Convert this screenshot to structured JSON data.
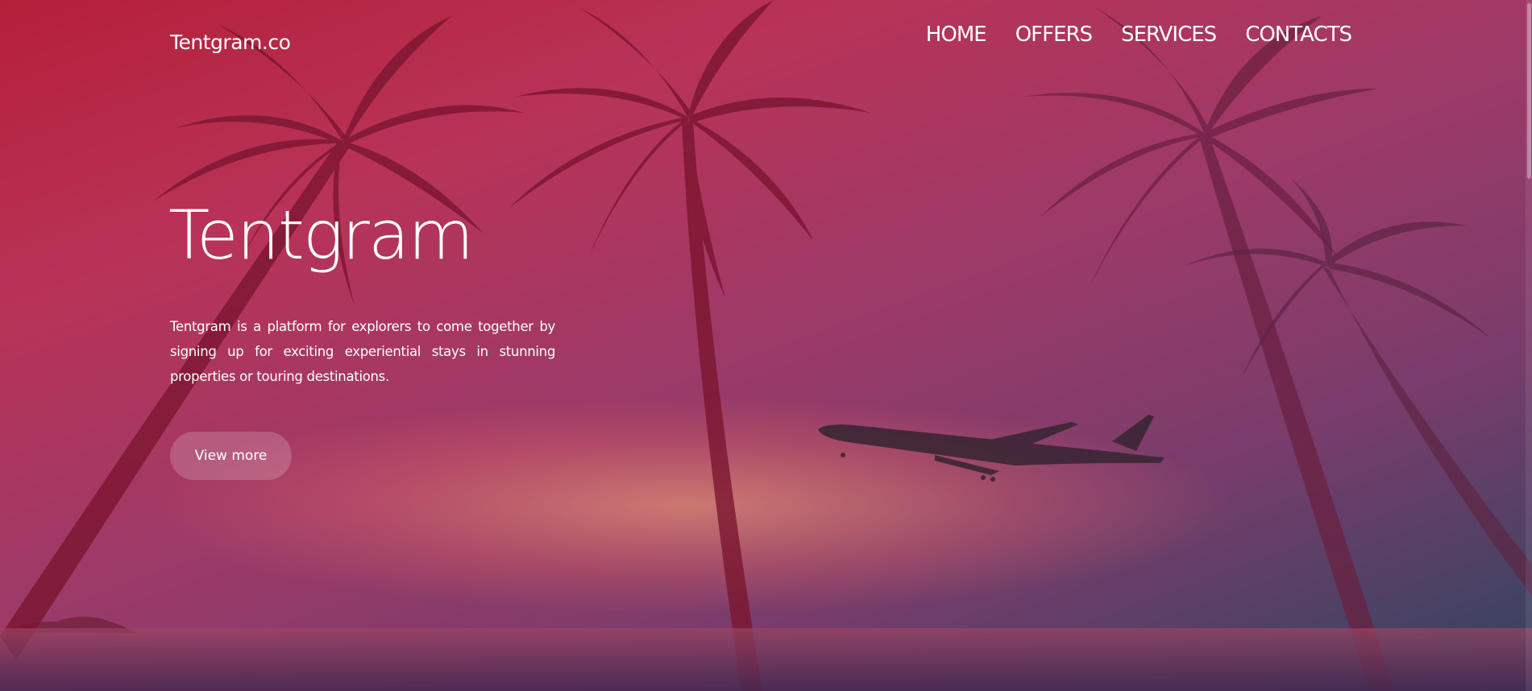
{
  "brand": {
    "logo_text": "Tentgram.co"
  },
  "nav": {
    "items": [
      {
        "label": "HOME"
      },
      {
        "label": "OFFERS"
      },
      {
        "label": "SERVICES"
      },
      {
        "label": "CONTACTS"
      }
    ]
  },
  "hero": {
    "title": "Tentgram",
    "description": "Tentgram is a platform for explorers to come together by signing up for exciting experiential stays in stunning properties or touring destinations.",
    "cta_label": "View more"
  },
  "background": {
    "scene": "palm-trees-sunset-airplane",
    "colors": {
      "top_left": "#b51f3a",
      "middle": "#9c3a68",
      "bottom_right": "#2f4560",
      "silhouette": "#7c1a35"
    }
  }
}
